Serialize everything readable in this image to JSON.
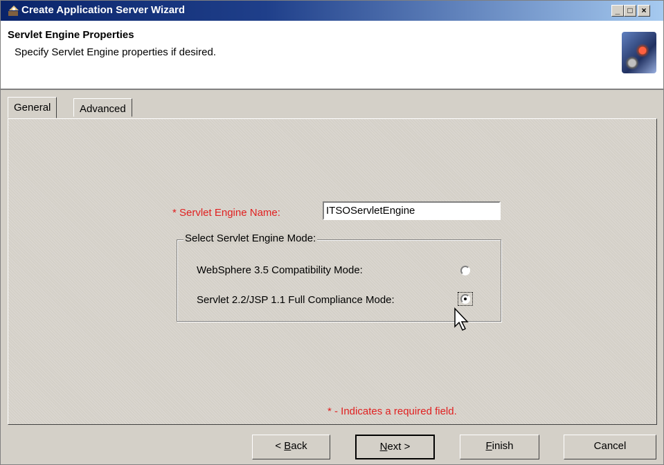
{
  "window": {
    "title": "Create Application Server Wizard",
    "controls": {
      "minimize_icon": "minimize-icon",
      "maximize_icon": "maximize-icon",
      "close_icon": "close-icon"
    }
  },
  "header": {
    "title": "Servlet Engine Properties",
    "subtitle": "Specify Servlet Engine properties if desired."
  },
  "tabs": [
    {
      "label": "General",
      "active": true
    },
    {
      "label": "Advanced",
      "active": false
    }
  ],
  "form": {
    "name_label": "* Servlet Engine Name:",
    "name_value": "ITSOServletEngine",
    "mode_group_label": "Select Servlet Engine Mode:",
    "options": [
      {
        "label": "WebSphere 3.5 Compatibility Mode:",
        "selected": false
      },
      {
        "label": "Servlet 2.2/JSP 1.1 Full Compliance Mode:",
        "selected": true
      }
    ],
    "required_note": "* - Indicates a required field."
  },
  "buttons": {
    "back": {
      "prefix": "< ",
      "mnemonic": "B",
      "rest": "ack"
    },
    "next": {
      "mnemonic": "N",
      "rest": "ext >"
    },
    "finish": {
      "mnemonic": "F",
      "rest": "inish"
    },
    "cancel": "Cancel"
  },
  "colors": {
    "title_bar": "#0a246a",
    "required_text": "#e02020",
    "dialog_bg": "#d4d0c8"
  }
}
